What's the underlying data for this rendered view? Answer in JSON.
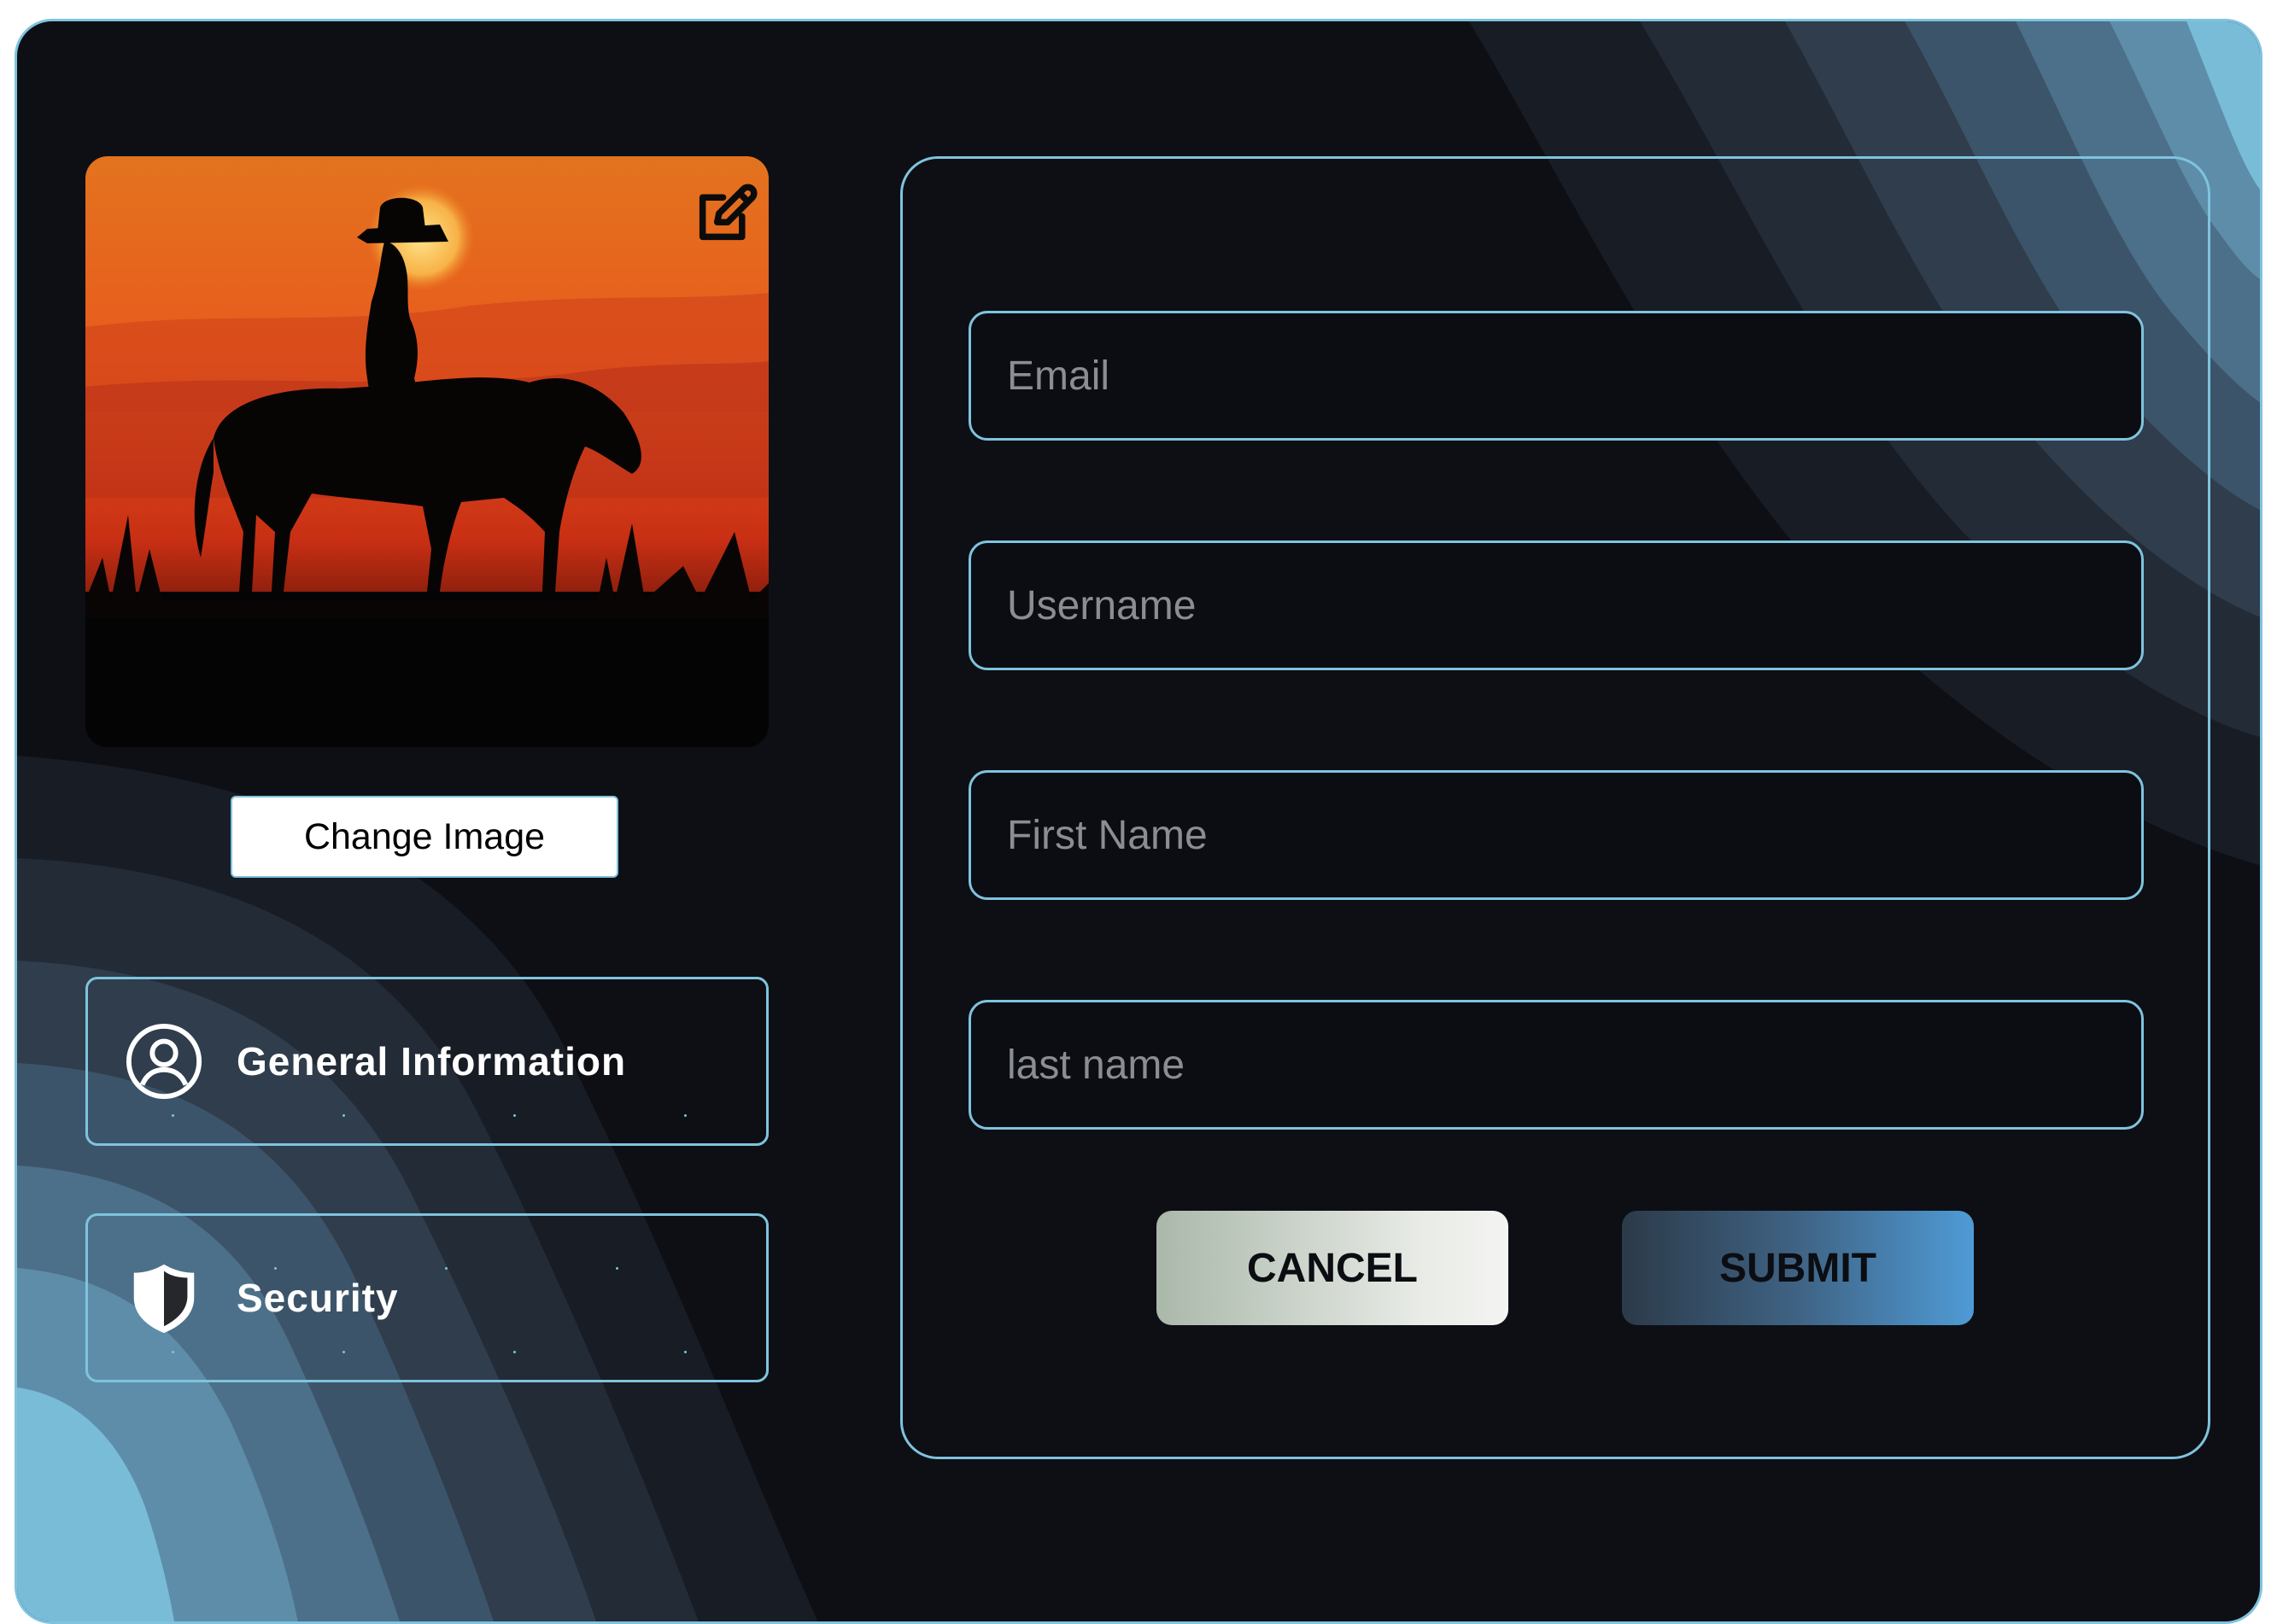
{
  "profile": {
    "photo_alt": "Cowgirl on horse at sunset",
    "edit_icon": "edit-square-icon",
    "change_image_label": "Change Image"
  },
  "nav": {
    "items": [
      {
        "label": "General Information",
        "icon": "user-circle-icon"
      },
      {
        "label": "Security",
        "icon": "shield-icon"
      }
    ]
  },
  "form": {
    "fields": [
      {
        "placeholder": "Email",
        "value": ""
      },
      {
        "placeholder": "Username",
        "value": ""
      },
      {
        "placeholder": "First Name",
        "value": ""
      },
      {
        "placeholder": "last name",
        "value": ""
      }
    ],
    "cancel_label": "CANCEL",
    "submit_label": "SUBMIT"
  },
  "colors": {
    "background": "#0d0f14",
    "accent_border": "#7fc3de",
    "wave_light": "#7fc3de"
  }
}
